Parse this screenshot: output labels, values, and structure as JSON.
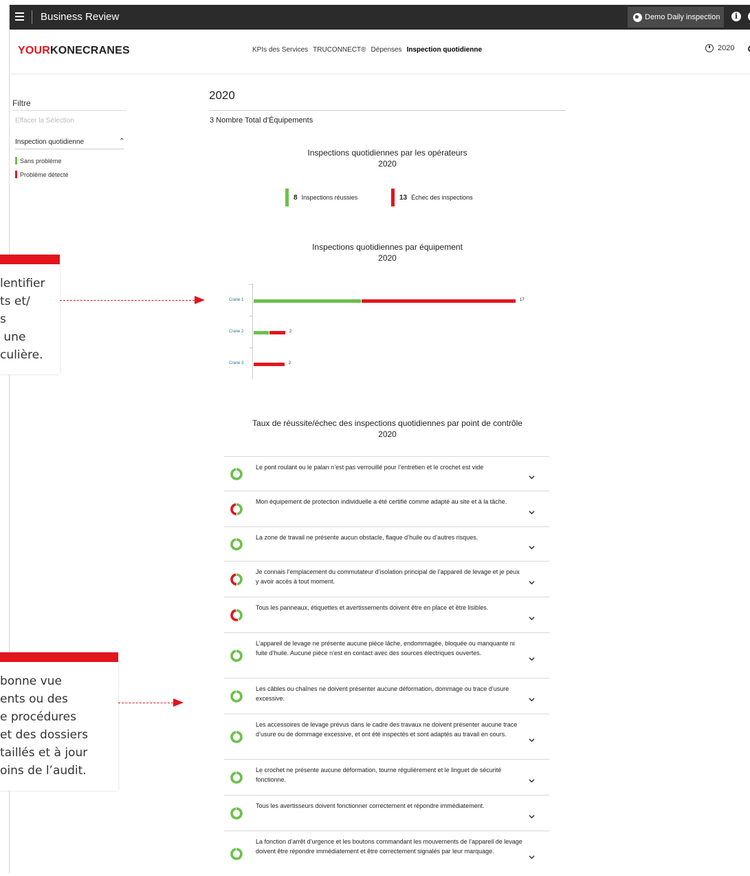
{
  "topbar": {
    "app_title": "Business Review",
    "demo_label": "Demo Daily inspection",
    "info_label": "i"
  },
  "header": {
    "logo_your": "YOUR",
    "logo_kc": "KONECRANES",
    "nav": [
      "KPIs des Services",
      "TRUCONNECT®",
      "Dépenses",
      "Inspection quotidienne"
    ],
    "active_nav": "Inspection quotidienne",
    "year_selector": "2020"
  },
  "sidebar": {
    "title": "Filtre",
    "clear": "Effacer la Sélection",
    "section": "Inspection quotidienne",
    "legend": [
      {
        "label": "Sans problème",
        "color": "#6cc04a"
      },
      {
        "label": "Problème détecté",
        "color": "#e3141c"
      }
    ]
  },
  "callouts": [
    {
      "text": "lentifier\nts et/\ns\n une\nculière."
    },
    {
      "text": "bonne vue\nents ou des\ne procédures\net des dossiers\ntaillés et à jour\noins de l’audit."
    }
  ],
  "main": {
    "year": "2020",
    "total_equipment": "3 Nombre Total d’Équipements",
    "operators_title": "Inspections quotidiennes par les opérateurs",
    "operators_year": "2020",
    "kpi_pass": {
      "value": "8",
      "label": "Inspections réussies",
      "color": "#6cc04a"
    },
    "kpi_fail": {
      "value": "13",
      "label": "Échec des inspections",
      "color": "#e3141c"
    },
    "equipment_title": "Inspections quotidiennes par équipement",
    "equipment_year": "2020",
    "checkpoint_title": "Taux de réussite/échec des inspections quotidiennes par point de contrôle",
    "checkpoint_year": "2020"
  },
  "chart_data": {
    "type": "bar",
    "stacked": true,
    "orientation": "horizontal",
    "categories": [
      "Crane 1",
      "Crane 2",
      "Crane 3"
    ],
    "series": [
      {
        "name": "Sans problème",
        "color": "#6cc04a",
        "values": [
          7,
          1,
          0
        ]
      },
      {
        "name": "Problème détecté",
        "color": "#e3141c",
        "values": [
          10,
          1,
          2
        ]
      }
    ],
    "totals": [
      "17",
      "2",
      "2"
    ],
    "xlim": [
      0,
      17
    ]
  },
  "checkpoints": [
    {
      "text": "Le pont roulant ou le palan n’est pas verrouillé pour l’entretien et le crochet est vide",
      "fail_fraction": 0.0
    },
    {
      "text": "Mon équipement de protection individuelle a été certifié comme adapté au site et à la tâche.",
      "fail_fraction": 0.5
    },
    {
      "text": "La zone de travail ne présente aucun obstacle, flaque d’huile ou d’autres risques.",
      "fail_fraction": 0.0
    },
    {
      "text": "Je connais l’emplacement du commutateur d’isolation principal de l’appareil de levage et je peux y avoir accès à tout moment.",
      "fail_fraction": 0.5
    },
    {
      "text": "Tous les panneaux, étiquettes et avertissements doivent être en place et être lisibles.",
      "fail_fraction": 0.55
    },
    {
      "text": "L’appareil de levage ne présente aucune pièce lâche, endommagée, bloquée ou manquante ni fuite d’huile. Aucune pièce n’est en contact avec des sources électriques ouvertes.",
      "fail_fraction": 0.0
    },
    {
      "text": "Les câbles ou chaînes ne doivent présenter aucune déformation, dommage ou trace d’usure excessive.",
      "fail_fraction": 0.0
    },
    {
      "text": "Les accessoires de levage prévus dans le cadre des travaux ne doivent présenter aucune trace d’usure ou de dommage excessive, et ont été inspectés et sont adaptés au travail en cours.",
      "fail_fraction": 0.0
    },
    {
      "text": "Le crochet ne présente aucune déformation, tourne régulièrement et le linguet de sécurité fonctionne.",
      "fail_fraction": 0.0
    },
    {
      "text": "Tous les avertisseurs doivent fonctionner correctement et répondre immédiatement.",
      "fail_fraction": 0.0
    },
    {
      "text": "La fonction d’arrêt d’urgence et les boutons commandant les mouvements de l’appareil de levage doivent être répondre immédiatement et être correctement signalés par leur marquage.",
      "fail_fraction": 0.0
    }
  ],
  "colors": {
    "pass": "#6cc04a",
    "fail": "#e3141c",
    "accent": "#e3141c"
  }
}
